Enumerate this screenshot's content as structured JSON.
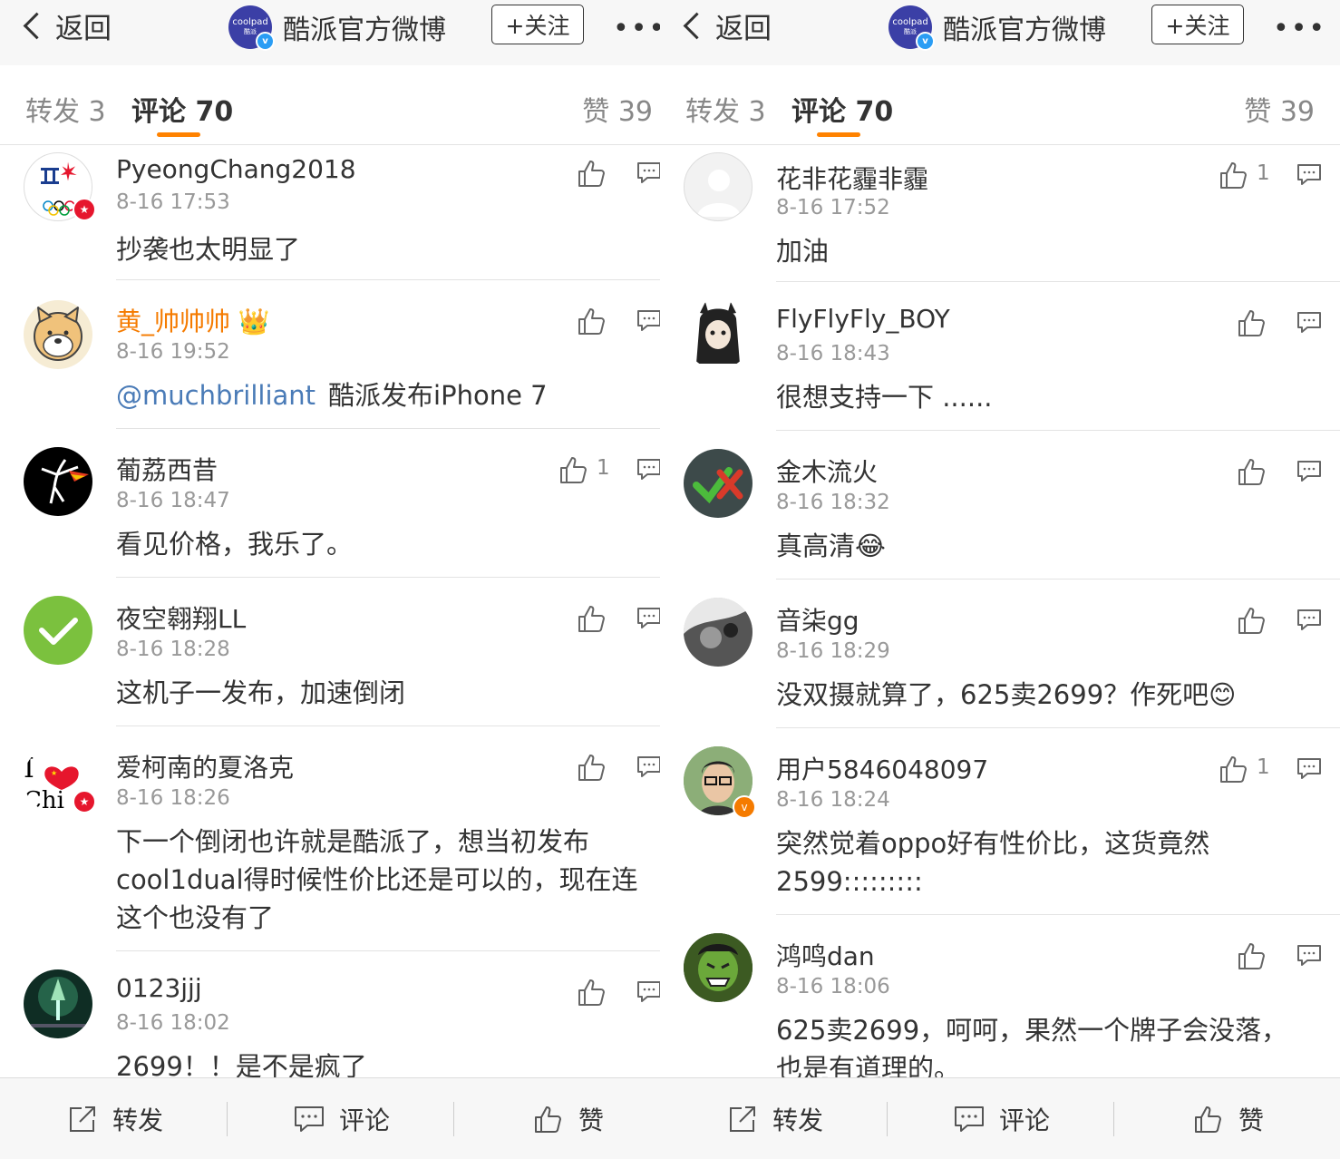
{
  "panels": [
    {
      "nav": {
        "back_label": "返回",
        "title": "酷派官方微博",
        "logo_text": "coolpad",
        "logo_sub": "酷派",
        "verified_mark": "v",
        "follow_label": "+关注",
        "more_label": "•••"
      },
      "tabs": {
        "repost": "转发 3",
        "comment": "评论 70",
        "like": "赞 39"
      },
      "comments": [
        {
          "name": "PyeongChang2018",
          "time": "8-16 17:53",
          "text": "抄袭也太明显了",
          "likes": "",
          "badge": "red",
          "avatar": "olympic"
        },
        {
          "name": "黄_帅帅帅 👑",
          "name_color": "orange",
          "time": "8-16 19:52",
          "mention": "@muchbrilliant",
          "text": "酷派发布iPhone 7",
          "likes": "",
          "badge": "",
          "avatar": "shiba"
        },
        {
          "name": "葡荔西昔",
          "time": "8-16 18:47",
          "text": "看见价格，我乐了。",
          "likes": "1",
          "badge": "",
          "avatar": "dancer"
        },
        {
          "name": "夜空翱翔LL",
          "time": "8-16 18:28",
          "text": "这机子一发布，加速倒闭",
          "likes": "",
          "badge": "",
          "avatar": "check"
        },
        {
          "name": "爱柯南的夏洛克",
          "time": "8-16 18:26",
          "text": "下一个倒闭也许就是酷派了，想当初发布cool1dual得时候性价比还是可以的，现在连这个也没有了",
          "likes": "",
          "badge": "red",
          "avatar": "ilovechina"
        },
        {
          "name": "0123jjj",
          "time": "8-16 18:02",
          "text": "2699！！是不是疯了",
          "likes": "",
          "badge": "",
          "avatar": "forest"
        }
      ],
      "bottom": {
        "repost": "转发",
        "comment": "评论",
        "like": "赞"
      }
    },
    {
      "nav": {
        "back_label": "返回",
        "title": "酷派官方微博",
        "logo_text": "coolpad",
        "logo_sub": "酷派",
        "verified_mark": "v",
        "follow_label": "+关注",
        "more_label": "•••"
      },
      "tabs": {
        "repost": "转发 3",
        "comment": "评论 70",
        "like": "赞 39"
      },
      "comments": [
        {
          "name": "花非花霾非霾",
          "time": "8-16 17:52",
          "text": "加油",
          "likes": "1",
          "badge": "",
          "avatar": "default"
        },
        {
          "name": "FlyFlyFly_BOY",
          "time": "8-16 18:43",
          "text": "很想支持一下 ......",
          "likes": "",
          "badge": "",
          "avatar": "anime"
        },
        {
          "name": "金木流火",
          "time": "8-16 18:32",
          "text": "真高清😂",
          "likes": "",
          "badge": "",
          "avatar": "checkx"
        },
        {
          "name": "音柒gg",
          "time": "8-16 18:29",
          "text": "没双摄就算了，625卖2699？作死吧😊",
          "likes": "",
          "badge": "",
          "avatar": "bw"
        },
        {
          "name": "用户5846048097",
          "time": "8-16 18:24",
          "text": "突然觉着oppo好有性价比，这货竟然2599:::::::::",
          "likes": "1",
          "badge": "orange",
          "avatar": "glasses"
        },
        {
          "name": "鸿鸣dan",
          "time": "8-16 18:06",
          "text": "625卖2699，呵呵，果然一个牌子会没落，也是有道理的。",
          "likes": "",
          "badge": "",
          "avatar": "hulk"
        }
      ],
      "bottom": {
        "repost": "转发",
        "comment": "评论",
        "like": "赞"
      }
    }
  ]
}
